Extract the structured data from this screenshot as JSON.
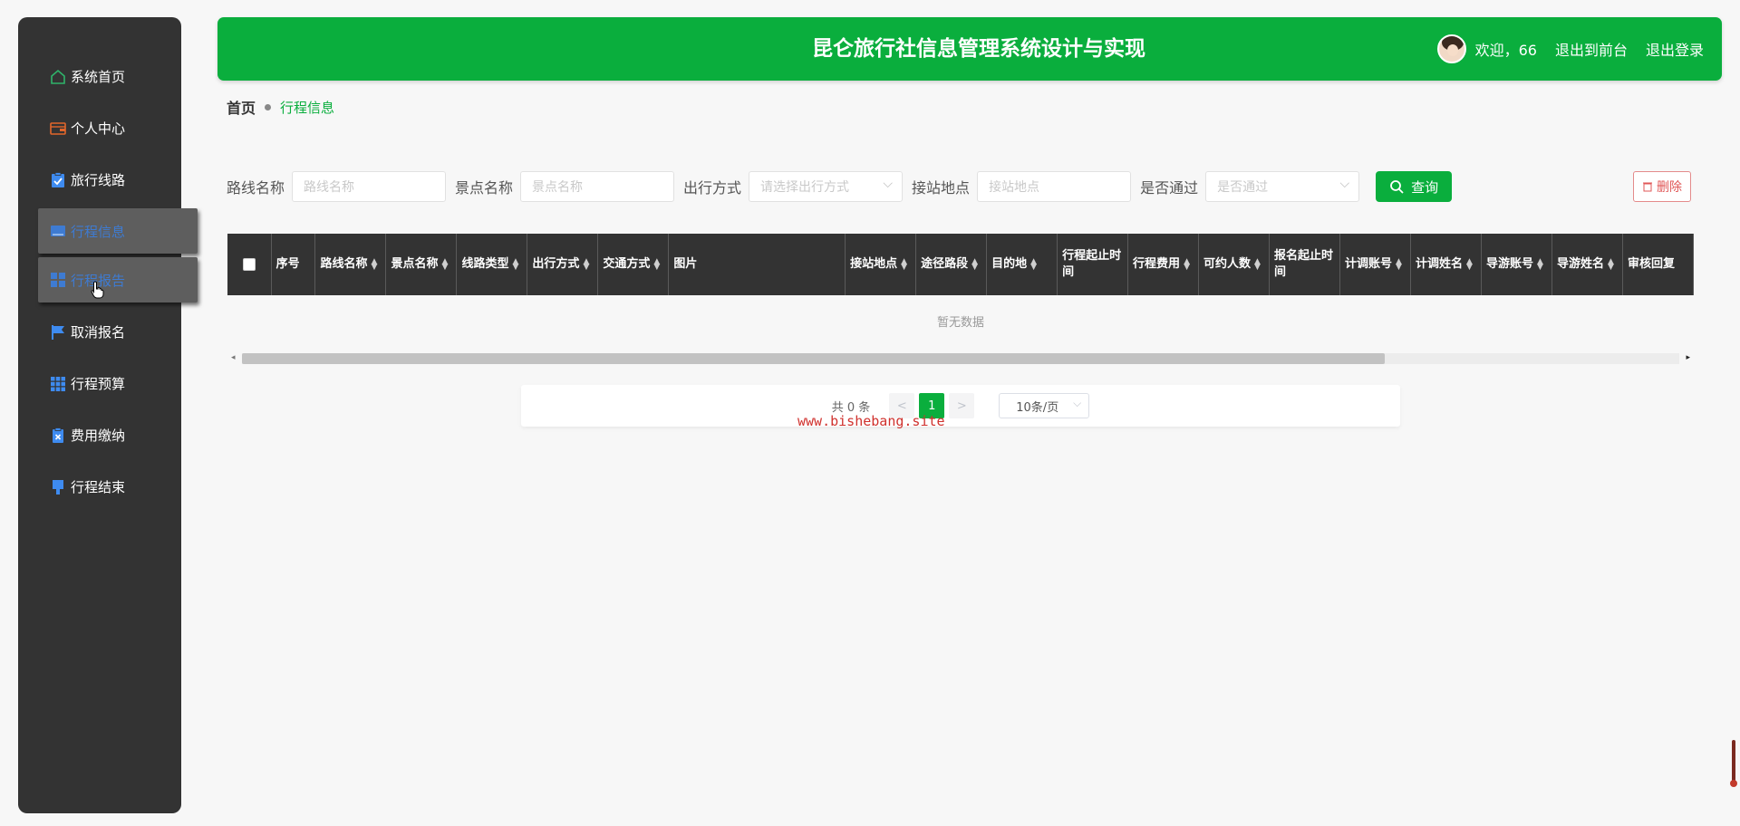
{
  "header": {
    "title": "昆仑旅行社信息管理系统设计与实现",
    "welcome": "欢迎，66",
    "back_to_front": "退出到前台",
    "logout": "退出登录"
  },
  "sidebar": {
    "items": [
      {
        "label": "系统首页",
        "icon": "home-icon",
        "color": "#2fb36a"
      },
      {
        "label": "个人中心",
        "icon": "wallet-icon",
        "color": "#e2662b"
      },
      {
        "label": "旅行线路",
        "icon": "clipboard-check-icon",
        "color": "#3e8bf0"
      },
      {
        "label": "行程信息",
        "icon": "card-icon",
        "color": "#3e8bf0",
        "active": true
      },
      {
        "label": "行程报告",
        "icon": "grid-icon",
        "color": "#3e8bf0",
        "active": true
      },
      {
        "label": "取消报名",
        "icon": "flag-icon",
        "color": "#3e8bf0"
      },
      {
        "label": "行程预算",
        "icon": "apps-icon",
        "color": "#3e8bf0"
      },
      {
        "label": "费用缴纳",
        "icon": "doc-x-icon",
        "color": "#3e8bf0"
      },
      {
        "label": "行程结束",
        "icon": "pin-icon",
        "color": "#3e8bf0"
      }
    ]
  },
  "breadcrumb": {
    "home": "首页",
    "current": "行程信息"
  },
  "search": {
    "route_label": "路线名称",
    "route_placeholder": "路线名称",
    "spot_label": "景点名称",
    "spot_placeholder": "景点名称",
    "travel_label": "出行方式",
    "travel_placeholder": "请选择出行方式",
    "station_label": "接站地点",
    "station_placeholder": "接站地点",
    "pass_label": "是否通过",
    "pass_placeholder": "是否通过",
    "query_button": "查询",
    "delete_button": "删除"
  },
  "table": {
    "columns": [
      "序号",
      "路线名称",
      "景点名称",
      "线路类型",
      "出行方式",
      "交通方式",
      "图片",
      "接站地点",
      "途径路段",
      "目的地",
      "行程起止时间",
      "行程费用",
      "可约人数",
      "报名起止时间",
      "计调账号",
      "计调姓名",
      "导游账号",
      "导游姓名",
      "审核回复"
    ],
    "empty_text": "暂无数据"
  },
  "pagination": {
    "total": "共 0 条",
    "prev": "<",
    "current": "1",
    "next": ">",
    "page_size": "10条/页"
  },
  "watermark": "www.bishebang.site",
  "colors": {
    "accent": "#0aae3d",
    "sidebar_bg": "#333333",
    "danger": "#e05757"
  }
}
